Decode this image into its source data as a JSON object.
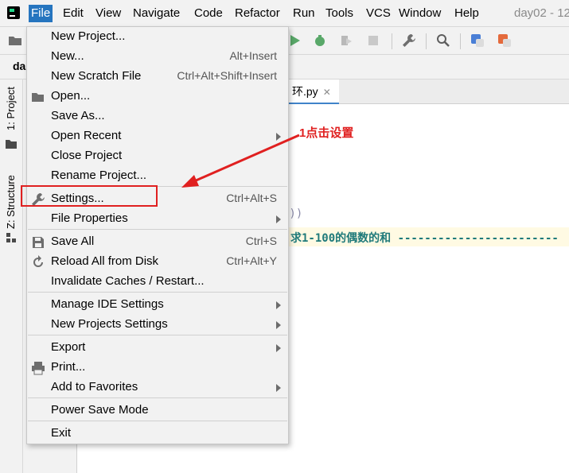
{
  "menubar": {
    "items": [
      "File",
      "Edit",
      "View",
      "Navigate",
      "Code",
      "Refactor",
      "Run",
      "Tools",
      "VCS",
      "Window",
      "Help"
    ],
    "title": "day02 - 12"
  },
  "breadcrumb": {
    "project": "da"
  },
  "left_strip": {
    "tab_project": "1: Project",
    "tab_structure": "Z: Structure"
  },
  "editor": {
    "tab_label": "环.py",
    "code_line_1": "n))",
    "code_line_2": "求1-100的偶数的和 ------------------------"
  },
  "annotation": {
    "text": "1点击设置"
  },
  "file_menu": {
    "new_project": "New Project...",
    "new": "New...",
    "new_shortcut": "Alt+Insert",
    "new_scratch": "New Scratch File",
    "new_scratch_shortcut": "Ctrl+Alt+Shift+Insert",
    "open": "Open...",
    "save_as": "Save As...",
    "open_recent": "Open Recent",
    "close_project": "Close Project",
    "rename_project": "Rename Project...",
    "settings": "Settings...",
    "settings_shortcut": "Ctrl+Alt+S",
    "file_properties": "File Properties",
    "save_all": "Save All",
    "save_all_shortcut": "Ctrl+S",
    "reload": "Reload All from Disk",
    "reload_shortcut": "Ctrl+Alt+Y",
    "invalidate": "Invalidate Caches / Restart...",
    "manage_ide": "Manage IDE Settings",
    "new_projects_settings": "New Projects Settings",
    "export": "Export",
    "print": "Print...",
    "add_to_favorites": "Add to Favorites",
    "power_save": "Power Save Mode",
    "exit": "Exit"
  },
  "colors": {
    "menu_active": "#2675bf",
    "annotation": "#e02020"
  }
}
